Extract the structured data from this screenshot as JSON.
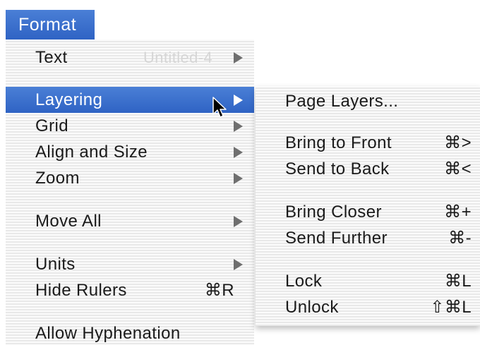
{
  "menubar": {
    "title": "Format"
  },
  "main_menu": {
    "ghost_text": "Untitled-4",
    "items": [
      {
        "label": "Text",
        "submenu": true
      },
      {
        "label": "Layering",
        "submenu": true,
        "highlighted": true
      },
      {
        "label": "Grid",
        "submenu": true
      },
      {
        "label": "Align and Size",
        "submenu": true
      },
      {
        "label": "Zoom",
        "submenu": true
      },
      {
        "label": "Move All",
        "submenu": true
      },
      {
        "label": "Units",
        "submenu": true
      },
      {
        "label": "Hide Rulers",
        "shortcut": "⌘R"
      },
      {
        "label": "Allow Hyphenation"
      }
    ]
  },
  "sub_menu": {
    "items": [
      {
        "label": "Page Layers..."
      },
      {
        "label": "Bring to Front",
        "shortcut": "⌘>"
      },
      {
        "label": "Send to Back",
        "shortcut": "⌘<"
      },
      {
        "label": "Bring Closer",
        "shortcut": "⌘+"
      },
      {
        "label": "Send Further",
        "shortcut": "⌘-"
      },
      {
        "label": "Lock",
        "shortcut": "⌘L"
      },
      {
        "label": "Unlock",
        "shortcut": "⇧⌘L"
      }
    ]
  },
  "colors": {
    "highlight": "#3a6fce",
    "text": "#1a1a1a",
    "highlight_text": "#ffffff"
  },
  "icons": {
    "cursor": "arrow-pointer-icon",
    "submenu": "triangle-right-icon"
  }
}
